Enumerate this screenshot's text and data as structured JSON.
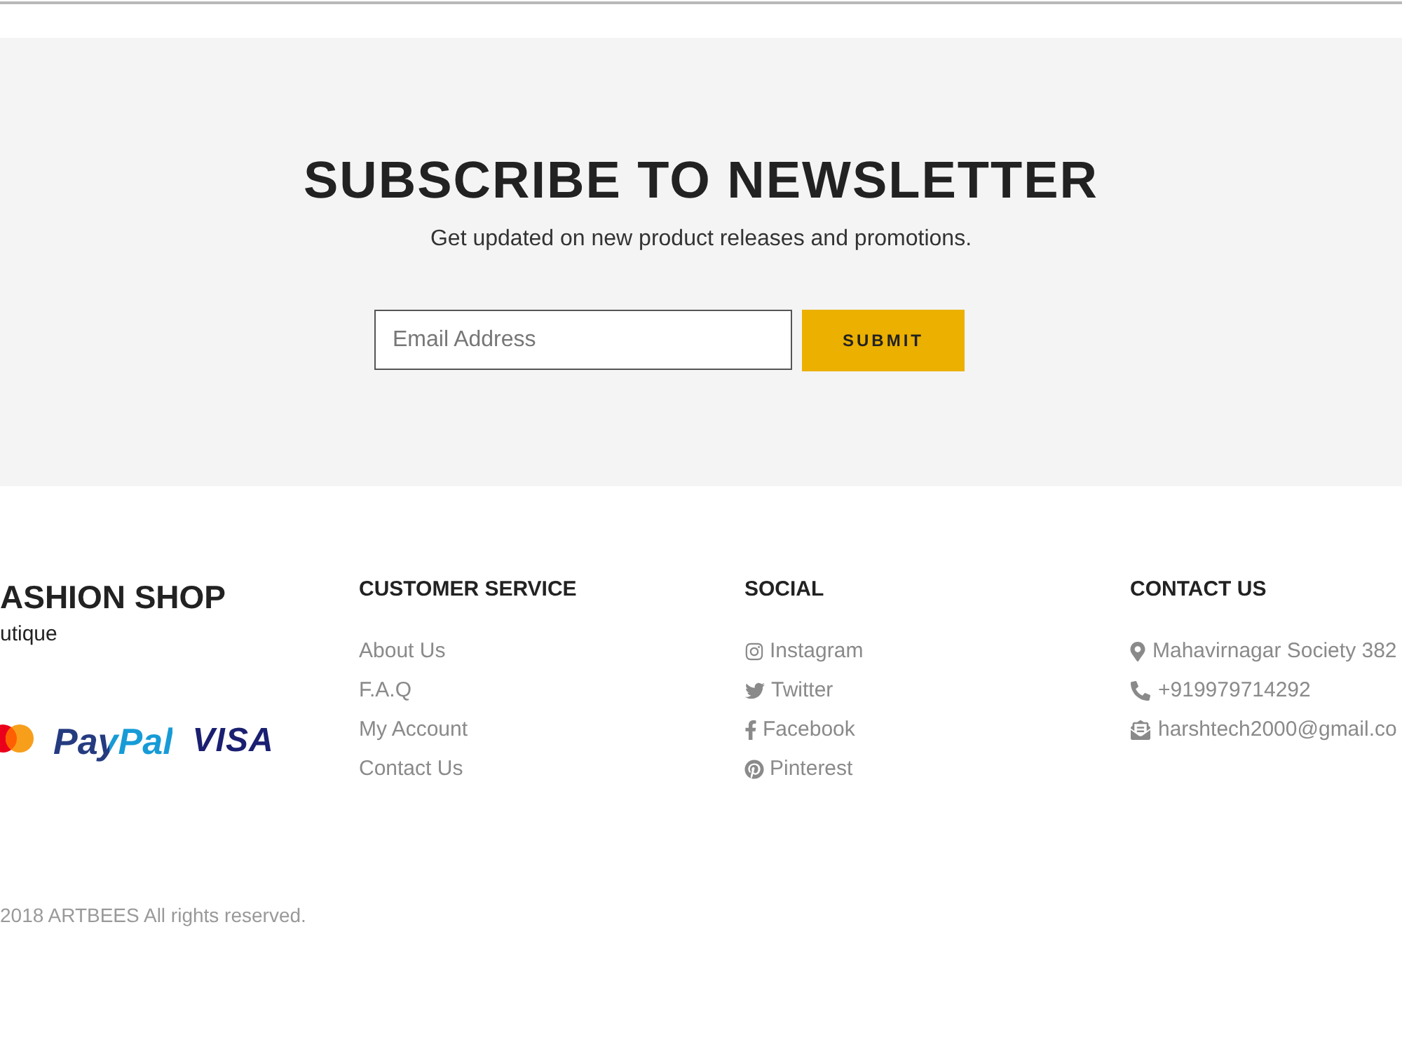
{
  "newsletter": {
    "title": "SUBSCRIBE TO NEWSLETTER",
    "subtitle": "Get updated on new product releases and promotions.",
    "email_field": {
      "placeholder": "Email Address"
    },
    "submit_button": {
      "label": "SUBMIT"
    }
  },
  "footer": {
    "brand": {
      "name": "ASHION SHOP",
      "tagline": "utique",
      "payment_logos": [
        {
          "kind": "emblem"
        },
        {
          "kind": "two_tone_wordmark",
          "label": "PayPal"
        },
        {
          "kind": "wordmark",
          "label": "VISA"
        }
      ]
    },
    "columns": [
      {
        "kind": "plain",
        "heading": "CUSTOMER SERVICE",
        "items": [
          "About Us",
          "F.A.Q",
          "My Account",
          "Contact Us"
        ]
      },
      {
        "kind": "social",
        "heading": "SOCIAL",
        "items": [
          "Instagram",
          "Twitter",
          "Facebook",
          "Pinterest"
        ]
      },
      {
        "kind": "contact",
        "heading": "CONTACT US",
        "items": [
          "Mahavirnagar Society 382",
          "+919979714292",
          "harshtech2000@gmail.co"
        ]
      }
    ],
    "copyright": "2018 ARTBEES All rights reserved."
  }
}
